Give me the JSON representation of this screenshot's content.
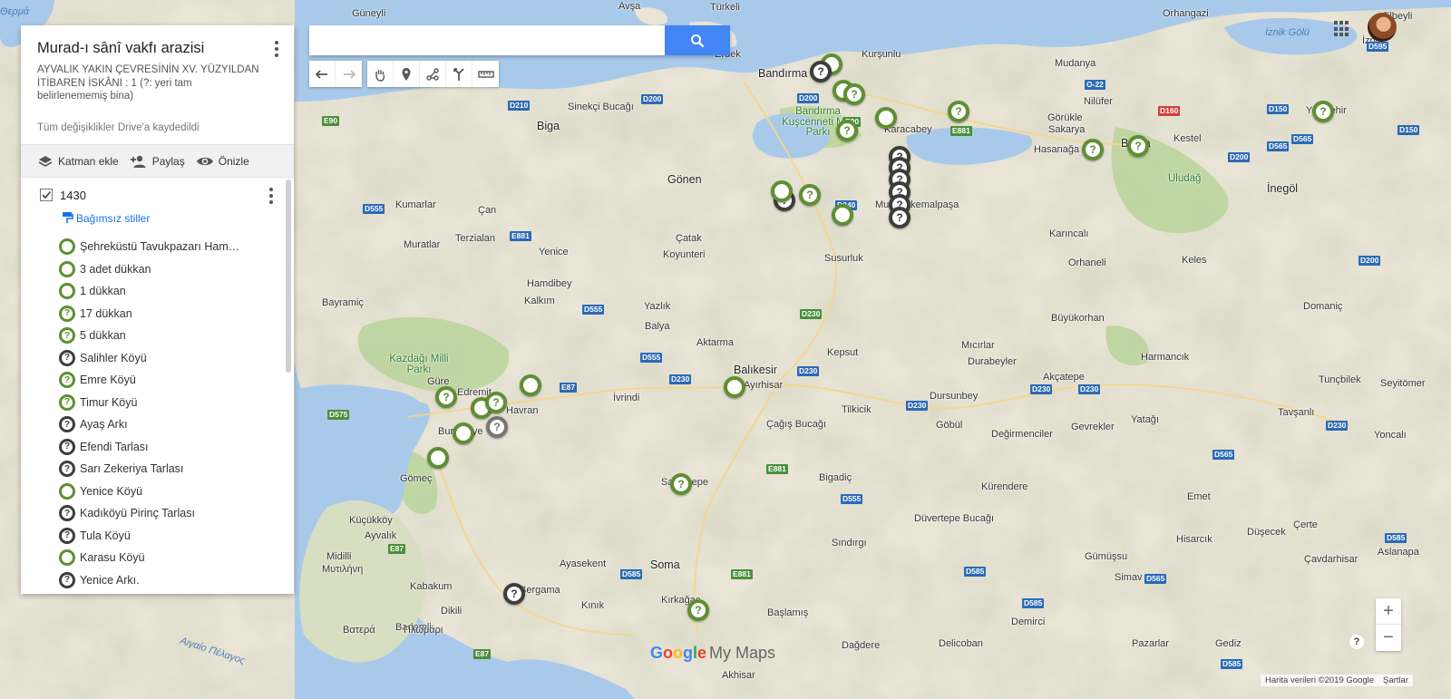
{
  "panel": {
    "title": "Murad-ı sânî vakfı arazisi",
    "description": "AYVALIK YAKIN ÇEVRESİNİN XV. YÜZYILDAN İTİBAREN İSKÂNI : 1 (?: yeri tam belirlenememiş bina)",
    "saved_status": "Tüm değişiklikler Drive'a kaydedildi",
    "actions": {
      "add_layer": "Katman ekle",
      "share": "Paylaş",
      "preview": "Önizle"
    },
    "layer": {
      "name": "1430",
      "checked": true,
      "styles_link": "Bağımsız stiller",
      "items": [
        {
          "label": "Şehreküstü Tavukpazarı Ham…",
          "style": "green",
          "icon": "circle"
        },
        {
          "label": "3 adet dükkan",
          "style": "green",
          "icon": "circle"
        },
        {
          "label": "1 dükkan",
          "style": "green",
          "icon": "circle"
        },
        {
          "label": "17 dükkan",
          "style": "green",
          "icon": "question"
        },
        {
          "label": "5 dükkan",
          "style": "green",
          "icon": "question"
        },
        {
          "label": "Salihler Köyü",
          "style": "dark",
          "icon": "question"
        },
        {
          "label": "Emre Köyü",
          "style": "green",
          "icon": "question"
        },
        {
          "label": "Timur Köyü",
          "style": "green",
          "icon": "question"
        },
        {
          "label": "Ayaş Arkı",
          "style": "dark",
          "icon": "question"
        },
        {
          "label": "Efendi Tarlası",
          "style": "dark",
          "icon": "question"
        },
        {
          "label": "Sarı Zekeriya Tarlası",
          "style": "dark",
          "icon": "question"
        },
        {
          "label": "Yenice Köyü",
          "style": "green",
          "icon": "circle"
        },
        {
          "label": "Kadıköyü Pirinç Tarlası",
          "style": "dark",
          "icon": "question"
        },
        {
          "label": "Tula Köyü",
          "style": "dark",
          "icon": "question"
        },
        {
          "label": "Karasu Köyü",
          "style": "green",
          "icon": "circle"
        },
        {
          "label": "Yenice Arkı.",
          "style": "dark",
          "icon": "question"
        }
      ]
    }
  },
  "search": {
    "value": "",
    "placeholder": ""
  },
  "toolbar": {
    "tools": [
      "undo-icon",
      "redo-icon",
      "hand-icon",
      "marker-icon",
      "draw-line-icon",
      "directions-icon",
      "ruler-icon"
    ]
  },
  "map": {
    "place_labels": [
      "Θερμά",
      "Güneyli",
      "Avşa",
      "Türkeli",
      "Orhangazi",
      "Elbeyli",
      "İznik Gölü",
      "İznik",
      "Erdek",
      "Bandırma",
      "Kurşunlu",
      "Mudanya",
      "Sinekçi Bucağı",
      "Biga",
      "Nilüfer",
      "Görükle",
      "Sakarya",
      "Karacabey",
      "Hasanağa",
      "Bursa",
      "Kestel",
      "Yenişehir",
      "Bandırma Kuşcenneti Milli Parkı",
      "Uludağ",
      "İnegöl",
      "Gönen",
      "Kumarlar",
      "Çan",
      "Mustafakemalpaşa",
      "Terzialan",
      "Yenice",
      "Koyunteri",
      "Çatak",
      "Susurluk",
      "Karıncalı",
      "Orhaneli",
      "Muratlar",
      "Hamdibey",
      "Keles",
      "Kalkım",
      "Bayramiç",
      "Yazlık",
      "Balya",
      "Büyükorhan",
      "Domaniç",
      "Kepsut",
      "Mıcırlar",
      "Durabeyler",
      "Harmancık",
      "Akçatepe",
      "Aktarma",
      "Kazdağı Milli Parkı",
      "Balıkesir",
      "Ayırhisar",
      "İvrindi",
      "Edremit",
      "Havran",
      "Güre",
      "Burhaniye",
      "Tilkicik",
      "Dursunbey",
      "Tunçbilek",
      "Seyitömer",
      "Çağış Bucağı",
      "Göbül",
      "Değirmenciler",
      "Gevrekler",
      "Yatağı",
      "Tavşanlı",
      "Yoncalı",
      "Gömeç",
      "Savaştepe",
      "Bigadiç",
      "Kürendere",
      "Emet",
      "Ayvalık",
      "Küçükköy",
      "Sındırgı",
      "Düvertepe Bucağı",
      "Çerte",
      "Düşecek",
      "Hisarcık",
      "Aslanapa",
      "Çavdarhisar",
      "Ayasekent",
      "Soma",
      "Gümüşsu",
      "Kabakum",
      "Bergama",
      "Kınık",
      "Kırkağaç",
      "Simav",
      "Midilli",
      "Μυτιλήνη",
      "Dikili",
      "Bademli",
      "Βατερά",
      "Πλωμάρι",
      "Αιγαίο Πέλαγος",
      "Akhisar",
      "Dağdere",
      "Başlamış",
      "Delicoban",
      "Demirci",
      "Pazarlar",
      "Gediz"
    ],
    "road_labels": [
      "E90",
      "D200",
      "D210",
      "D555",
      "E881",
      "D230",
      "E87",
      "D575",
      "O-22",
      "D160",
      "D150",
      "D595",
      "D565",
      "D240",
      "D585",
      "E87"
    ]
  },
  "branding": {
    "logo_google": "Google",
    "logo_mymaps": "My Maps"
  },
  "footer": {
    "copyright": "Harita verileri ©2019 Google",
    "terms": "Şartlar"
  },
  "colors": {
    "marker_green": "#5e8f32",
    "marker_dark": "#3d3d3d",
    "accent": "#4285f4",
    "water": "#a9c9ea"
  }
}
